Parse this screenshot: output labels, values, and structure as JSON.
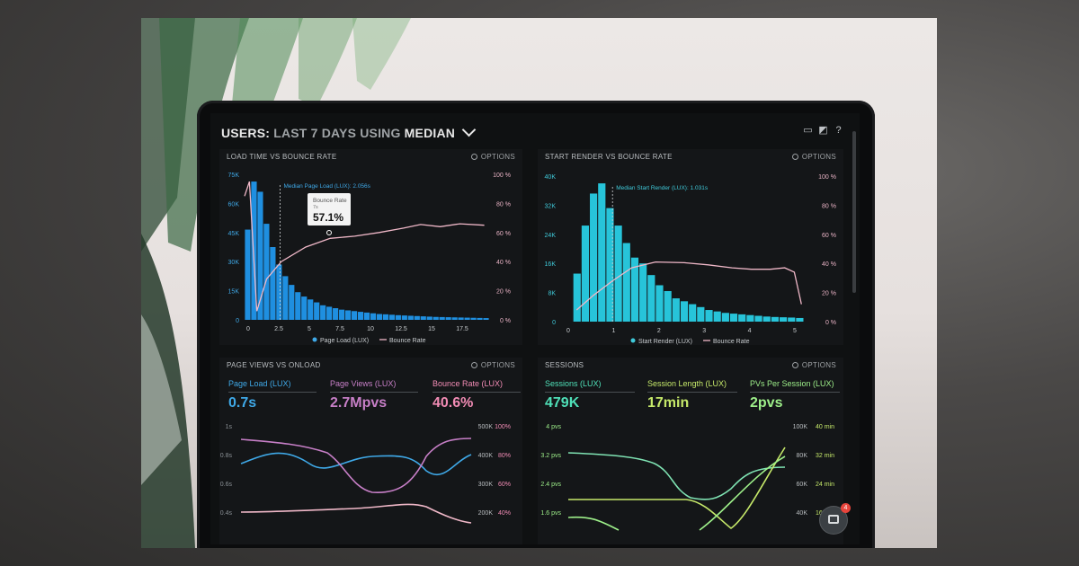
{
  "dashboard": {
    "title_prefix": "USERS:",
    "title_range": "LAST 7 DAYS",
    "title_using": "USING",
    "title_method": "MEDIAN"
  },
  "options_label": "OPTIONS",
  "panels": {
    "load_time": {
      "title": "LOAD TIME VS BOUNCE RATE",
      "median_label": "Median Page Load (LUX): 2.056s",
      "tooltip_label": "Bounce Rate",
      "tooltip_sub": "7s",
      "tooltip_value": "57.1%",
      "y_left_ticks": [
        "75K",
        "60K",
        "45K",
        "30K",
        "15K",
        "0"
      ],
      "y_right_ticks": [
        "100 %",
        "80 %",
        "60 %",
        "40 %",
        "20 %",
        "0 %"
      ],
      "x_ticks": [
        "0",
        "2.5",
        "5",
        "7.5",
        "10",
        "12.5",
        "15",
        "17.5"
      ],
      "legend": [
        "Page Load (LUX)",
        "Bounce Rate"
      ]
    },
    "start_render": {
      "title": "START RENDER VS BOUNCE RATE",
      "median_label": "Median Start Render (LUX): 1.031s",
      "y_left_ticks": [
        "40K",
        "32K",
        "24K",
        "16K",
        "8K",
        "0"
      ],
      "y_right_ticks": [
        "100 %",
        "80 %",
        "60 %",
        "40 %",
        "20 %",
        "0 %"
      ],
      "x_ticks": [
        "0",
        "1",
        "2",
        "3",
        "4",
        "5"
      ],
      "legend": [
        "Start Render (LUX)",
        "Bounce Rate"
      ]
    },
    "page_views": {
      "title": "PAGE VIEWS VS ONLOAD",
      "kpis": [
        {
          "label": "Page Load (LUX)",
          "value": "0.7s",
          "color": "#3fa9e8"
        },
        {
          "label": "Page Views (LUX)",
          "value": "2.7Mpvs",
          "color": "#c77fc7"
        },
        {
          "label": "Bounce Rate (LUX)",
          "value": "40.6%",
          "color": "#f28cb5"
        }
      ],
      "y_left_ticks": [
        "1s",
        "0.8s",
        "0.6s",
        "0.4s"
      ],
      "y_mid_ticks": [
        "500K",
        "400K",
        "300K",
        "200K"
      ],
      "y_right_ticks": [
        "100%",
        "80%",
        "60%",
        "40%"
      ]
    },
    "sessions": {
      "title": "SESSIONS",
      "kpis": [
        {
          "label": "Sessions (LUX)",
          "value": "479K",
          "color": "#4fe0b8"
        },
        {
          "label": "Session Length (LUX)",
          "value": "17min",
          "color": "#c6e96a"
        },
        {
          "label": "PVs Per Session (LUX)",
          "value": "2pvs",
          "color": "#9ef08a"
        }
      ],
      "y_left_ticks": [
        "4 pvs",
        "3.2 pvs",
        "2.4 pvs",
        "1.6 pvs"
      ],
      "y_mid_ticks": [
        "100K",
        "80K",
        "60K",
        "40K"
      ],
      "y_right_ticks": [
        "40 min",
        "32 min",
        "24 min",
        "16 min"
      ]
    }
  },
  "chat": {
    "badge": "4"
  },
  "colors": {
    "bar_blue": "#1f8fe0",
    "bar_cyan": "#27c4d9",
    "bounce_line": "#f0b8c8",
    "accent_green": "#4fe0b8"
  }
}
